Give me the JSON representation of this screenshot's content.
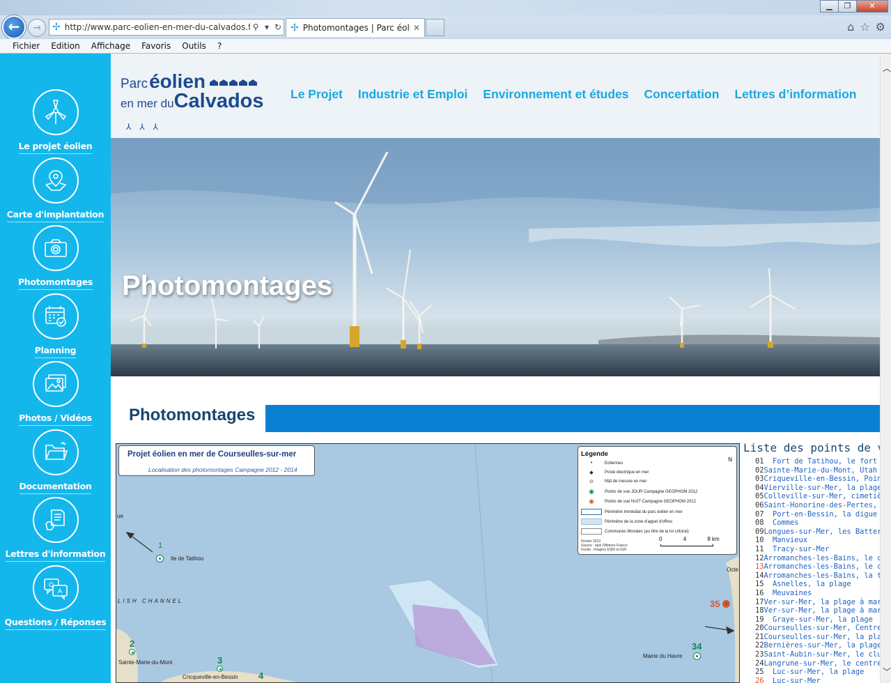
{
  "browser": {
    "url": "http://www.parc-eolien-en-mer-du-calvados.fr/l",
    "url_domain": "parc-eolien-en-mer-du-calvados.fr",
    "tab_title": "Photomontages | Parc éolie...",
    "menu": [
      "Fichier",
      "Edition",
      "Affichage",
      "Favoris",
      "Outils",
      "?"
    ]
  },
  "sidebar": {
    "items": [
      {
        "label": "Le projet éolien",
        "icon": "turbine-icon"
      },
      {
        "label": "Carte d'implantation",
        "icon": "map-pin-icon"
      },
      {
        "label": "Photomontages",
        "icon": "camera-icon"
      },
      {
        "label": "Planning",
        "icon": "calendar-icon"
      },
      {
        "label": "Photos / Vidéos",
        "icon": "photos-icon"
      },
      {
        "label": "Documentation",
        "icon": "folder-icon"
      },
      {
        "label": "Lettres d'information",
        "icon": "newsletter-icon"
      },
      {
        "label": "Questions / Réponses",
        "icon": "qa-bubbles-icon"
      }
    ]
  },
  "header": {
    "logo": {
      "l1a": "Parc",
      "l1b": "éolien",
      "l2a": "en mer",
      "l2b": "du",
      "l2c": "Calvados"
    },
    "nav": [
      "Le Projet",
      "Industrie et Emploi",
      "Environnement et études",
      "Concertation",
      "Lettres d’information"
    ]
  },
  "hero": {
    "title": "Photomontages"
  },
  "section": {
    "title": "Photomontages"
  },
  "map": {
    "title": "Projet éolien en mer de Courseulles-sur-mer",
    "subtitle": "Localisation des photomontages Campagne 2012 - 2014",
    "legend": {
      "title": "Légende",
      "rows": [
        "Eoliennes",
        "Poste électrique en mer",
        "Mât de mesure en mer",
        "Points de vue JOUR Campagne GEOPHOM 2012",
        "Points de vue NUIT Campagne GEOPHOM 2012",
        "Périmètre immédiat du parc éolien en mer",
        "Périmètre de la zone d'appel d'offres",
        "Communes littorales (au titre de la loi Littoral)"
      ],
      "source": [
        "Février 2013",
        "Source : epsi Offshore France",
        "Fonds : Imagery ESRI et IGN"
      ],
      "scale": [
        "0",
        "4",
        "8 km"
      ],
      "north": "N"
    },
    "labels": {
      "ue": "ue",
      "tatihou": "Ile de Tatihou",
      "channel": "LISH CHANNEL",
      "ste_marie": "Sainte-Marie-du-Mont",
      "cricqueville": "Cricqueville-en-Bessin",
      "mairie_havre": "Mairie du Havre",
      "octe": "Octe"
    },
    "points": {
      "p1": "1",
      "p2": "2",
      "p3": "3",
      "p4": "4",
      "p34": "34",
      "p35": "35"
    }
  },
  "list": {
    "title": "Liste des points de vue",
    "items": [
      {
        "num": "01",
        "name": "Fort de Tatihou, le fort"
      },
      {
        "num": "02",
        "name": "Sainte-Marie-du-Mont, Utah Beach"
      },
      {
        "num": "03",
        "name": "Criqueville-en-Bessin, Pointe du Hoc"
      },
      {
        "num": "04",
        "name": "Vierville-sur-Mer, la plage"
      },
      {
        "num": "05",
        "name": "Colleville-sur-Mer, cimetière américain"
      },
      {
        "num": "06",
        "name": "Saint-Honorine-des-Pertes, la plage"
      },
      {
        "num": "07",
        "name": "Port-en-Bessin, la digue"
      },
      {
        "num": "08",
        "name": "Commes"
      },
      {
        "num": "09",
        "name": "Longues-sur-Mer, les Batteries"
      },
      {
        "num": "10",
        "name": "Manvieux"
      },
      {
        "num": "11",
        "name": "Tracy-sur-Mer"
      },
      {
        "num": "12",
        "name": "Arromanches-les-Bains, le centre ville"
      },
      {
        "num": "13",
        "name": "Arromanches-les-Bains, le centre ville",
        "red": true
      },
      {
        "num": "14",
        "name": "Arromanches-les-Bains, la table d'orientation"
      },
      {
        "num": "15",
        "name": "Asnelles, la plage"
      },
      {
        "num": "16",
        "name": "Meuvaines"
      },
      {
        "num": "17",
        "name": "Ver-sur-Mer, la plage à marée haute"
      },
      {
        "num": "18",
        "name": "Ver-sur-Mer, la plage à marée basse"
      },
      {
        "num": "19",
        "name": "Graye-sur-Mer, la plage"
      },
      {
        "num": "20",
        "name": "Courseulles-sur-Mer, Centre Juno Beach"
      },
      {
        "num": "21",
        "name": "Courseulles-sur-Mer, la plage"
      },
      {
        "num": "22",
        "name": "Bernières-sur-Mer, la plage"
      },
      {
        "num": "23",
        "name": "Saint-Aubin-sur-Mer, le club de voile"
      },
      {
        "num": "24",
        "name": "Langrune-sur-Mer, le centre ville"
      },
      {
        "num": "25",
        "name": "Luc-sur-Mer, la plage"
      },
      {
        "num": "26",
        "name": "Luc-sur-Mer",
        "red": true
      }
    ]
  }
}
